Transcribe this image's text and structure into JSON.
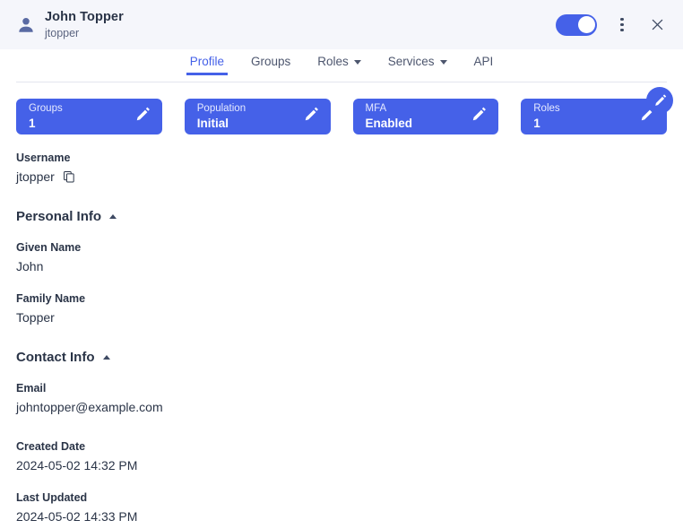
{
  "header": {
    "avatar_icon": "user-avatar-icon",
    "name": "John Topper",
    "username": "jtopper",
    "toggle": {
      "state": "on",
      "color": "#4561e8"
    },
    "menu_icon": "kebab-menu-icon",
    "close_icon": "close-icon"
  },
  "tabs": [
    {
      "label": "Profile",
      "active": true,
      "dropdown": false
    },
    {
      "label": "Groups",
      "active": false,
      "dropdown": false
    },
    {
      "label": "Roles",
      "active": false,
      "dropdown": true
    },
    {
      "label": "Services",
      "active": false,
      "dropdown": true
    },
    {
      "label": "API",
      "active": false,
      "dropdown": false
    }
  ],
  "cards": [
    {
      "label": "Groups",
      "value": "1",
      "edit_icon": "pencil-icon"
    },
    {
      "label": "Population",
      "value": "Initial",
      "edit_icon": "pencil-icon"
    },
    {
      "label": "MFA",
      "value": "Enabled",
      "edit_icon": "pencil-icon"
    },
    {
      "label": "Roles",
      "value": "1",
      "edit_icon": "pencil-icon"
    }
  ],
  "username_field": {
    "label": "Username",
    "value": "jtopper",
    "copy_icon": "copy-icon"
  },
  "edit_fab": {
    "icon": "pencil-icon",
    "color": "#4561e8"
  },
  "sections": [
    {
      "title": "Personal Info",
      "collapse_icon": "chevron-up-icon",
      "fields": [
        {
          "label": "Given Name",
          "value": "John"
        },
        {
          "label": "Family Name",
          "value": "Topper"
        }
      ]
    },
    {
      "title": "Contact Info",
      "collapse_icon": "chevron-up-icon",
      "fields": [
        {
          "label": "Email",
          "value": "johntopper@example.com"
        }
      ]
    }
  ],
  "meta_fields": [
    {
      "label": "Created Date",
      "value": "2024-05-02 14:32 PM"
    },
    {
      "label": "Last Updated",
      "value": "2024-05-02 14:33 PM"
    }
  ]
}
